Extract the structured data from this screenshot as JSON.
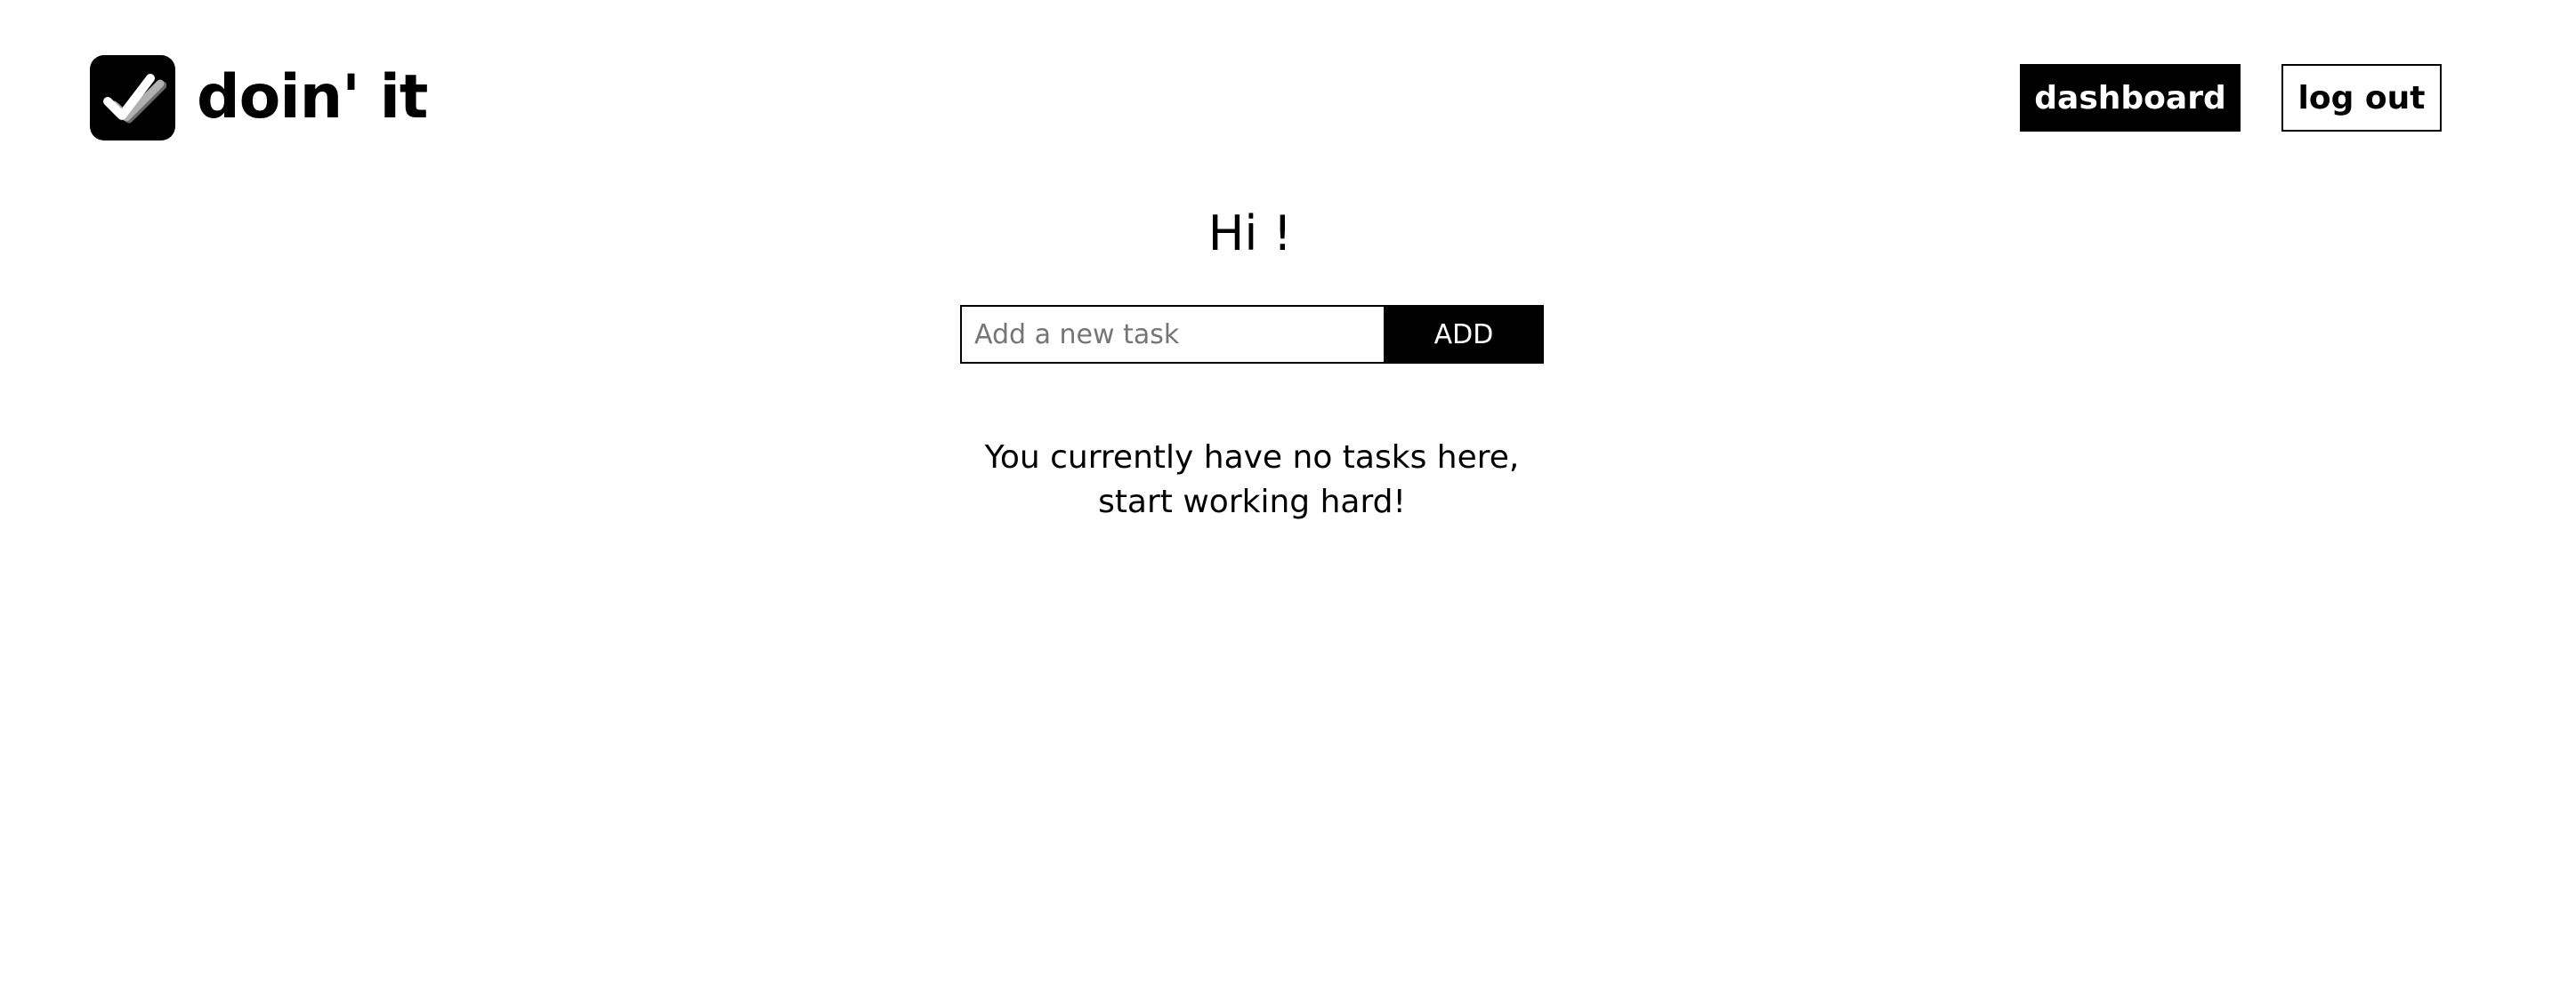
{
  "header": {
    "brand_name": "doin' it",
    "logo_icon": "checkmark-logo-icon",
    "nav": {
      "dashboard_label": "dashboard",
      "logout_label": "log out"
    }
  },
  "main": {
    "greeting": "Hi !",
    "task_form": {
      "input_placeholder": "Add a new task",
      "input_value": "",
      "add_label": "ADD"
    },
    "empty_message": "You currently have no tasks here, start working hard!"
  },
  "colors": {
    "primary": "#000000",
    "background": "#ffffff",
    "placeholder": "#757575"
  }
}
